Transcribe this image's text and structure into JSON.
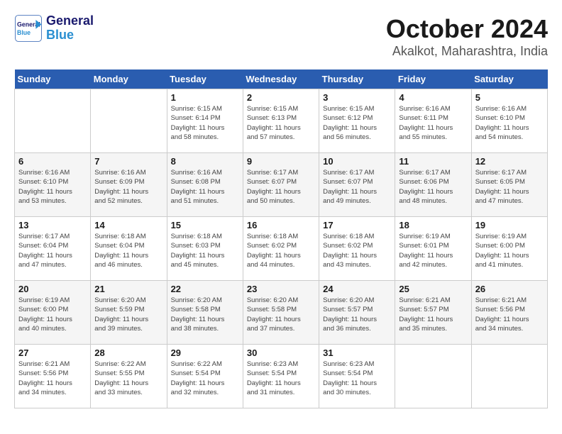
{
  "header": {
    "logo_line1": "General",
    "logo_line2": "Blue",
    "month": "October 2024",
    "location": "Akalkot, Maharashtra, India"
  },
  "weekdays": [
    "Sunday",
    "Monday",
    "Tuesday",
    "Wednesday",
    "Thursday",
    "Friday",
    "Saturday"
  ],
  "weeks": [
    [
      {
        "day": "",
        "info": ""
      },
      {
        "day": "",
        "info": ""
      },
      {
        "day": "1",
        "info": "Sunrise: 6:15 AM\nSunset: 6:14 PM\nDaylight: 11 hours\nand 58 minutes."
      },
      {
        "day": "2",
        "info": "Sunrise: 6:15 AM\nSunset: 6:13 PM\nDaylight: 11 hours\nand 57 minutes."
      },
      {
        "day": "3",
        "info": "Sunrise: 6:15 AM\nSunset: 6:12 PM\nDaylight: 11 hours\nand 56 minutes."
      },
      {
        "day": "4",
        "info": "Sunrise: 6:16 AM\nSunset: 6:11 PM\nDaylight: 11 hours\nand 55 minutes."
      },
      {
        "day": "5",
        "info": "Sunrise: 6:16 AM\nSunset: 6:10 PM\nDaylight: 11 hours\nand 54 minutes."
      }
    ],
    [
      {
        "day": "6",
        "info": "Sunrise: 6:16 AM\nSunset: 6:10 PM\nDaylight: 11 hours\nand 53 minutes."
      },
      {
        "day": "7",
        "info": "Sunrise: 6:16 AM\nSunset: 6:09 PM\nDaylight: 11 hours\nand 52 minutes."
      },
      {
        "day": "8",
        "info": "Sunrise: 6:16 AM\nSunset: 6:08 PM\nDaylight: 11 hours\nand 51 minutes."
      },
      {
        "day": "9",
        "info": "Sunrise: 6:17 AM\nSunset: 6:07 PM\nDaylight: 11 hours\nand 50 minutes."
      },
      {
        "day": "10",
        "info": "Sunrise: 6:17 AM\nSunset: 6:07 PM\nDaylight: 11 hours\nand 49 minutes."
      },
      {
        "day": "11",
        "info": "Sunrise: 6:17 AM\nSunset: 6:06 PM\nDaylight: 11 hours\nand 48 minutes."
      },
      {
        "day": "12",
        "info": "Sunrise: 6:17 AM\nSunset: 6:05 PM\nDaylight: 11 hours\nand 47 minutes."
      }
    ],
    [
      {
        "day": "13",
        "info": "Sunrise: 6:17 AM\nSunset: 6:04 PM\nDaylight: 11 hours\nand 47 minutes."
      },
      {
        "day": "14",
        "info": "Sunrise: 6:18 AM\nSunset: 6:04 PM\nDaylight: 11 hours\nand 46 minutes."
      },
      {
        "day": "15",
        "info": "Sunrise: 6:18 AM\nSunset: 6:03 PM\nDaylight: 11 hours\nand 45 minutes."
      },
      {
        "day": "16",
        "info": "Sunrise: 6:18 AM\nSunset: 6:02 PM\nDaylight: 11 hours\nand 44 minutes."
      },
      {
        "day": "17",
        "info": "Sunrise: 6:18 AM\nSunset: 6:02 PM\nDaylight: 11 hours\nand 43 minutes."
      },
      {
        "day": "18",
        "info": "Sunrise: 6:19 AM\nSunset: 6:01 PM\nDaylight: 11 hours\nand 42 minutes."
      },
      {
        "day": "19",
        "info": "Sunrise: 6:19 AM\nSunset: 6:00 PM\nDaylight: 11 hours\nand 41 minutes."
      }
    ],
    [
      {
        "day": "20",
        "info": "Sunrise: 6:19 AM\nSunset: 6:00 PM\nDaylight: 11 hours\nand 40 minutes."
      },
      {
        "day": "21",
        "info": "Sunrise: 6:20 AM\nSunset: 5:59 PM\nDaylight: 11 hours\nand 39 minutes."
      },
      {
        "day": "22",
        "info": "Sunrise: 6:20 AM\nSunset: 5:58 PM\nDaylight: 11 hours\nand 38 minutes."
      },
      {
        "day": "23",
        "info": "Sunrise: 6:20 AM\nSunset: 5:58 PM\nDaylight: 11 hours\nand 37 minutes."
      },
      {
        "day": "24",
        "info": "Sunrise: 6:20 AM\nSunset: 5:57 PM\nDaylight: 11 hours\nand 36 minutes."
      },
      {
        "day": "25",
        "info": "Sunrise: 6:21 AM\nSunset: 5:57 PM\nDaylight: 11 hours\nand 35 minutes."
      },
      {
        "day": "26",
        "info": "Sunrise: 6:21 AM\nSunset: 5:56 PM\nDaylight: 11 hours\nand 34 minutes."
      }
    ],
    [
      {
        "day": "27",
        "info": "Sunrise: 6:21 AM\nSunset: 5:56 PM\nDaylight: 11 hours\nand 34 minutes."
      },
      {
        "day": "28",
        "info": "Sunrise: 6:22 AM\nSunset: 5:55 PM\nDaylight: 11 hours\nand 33 minutes."
      },
      {
        "day": "29",
        "info": "Sunrise: 6:22 AM\nSunset: 5:54 PM\nDaylight: 11 hours\nand 32 minutes."
      },
      {
        "day": "30",
        "info": "Sunrise: 6:23 AM\nSunset: 5:54 PM\nDaylight: 11 hours\nand 31 minutes."
      },
      {
        "day": "31",
        "info": "Sunrise: 6:23 AM\nSunset: 5:54 PM\nDaylight: 11 hours\nand 30 minutes."
      },
      {
        "day": "",
        "info": ""
      },
      {
        "day": "",
        "info": ""
      }
    ]
  ]
}
